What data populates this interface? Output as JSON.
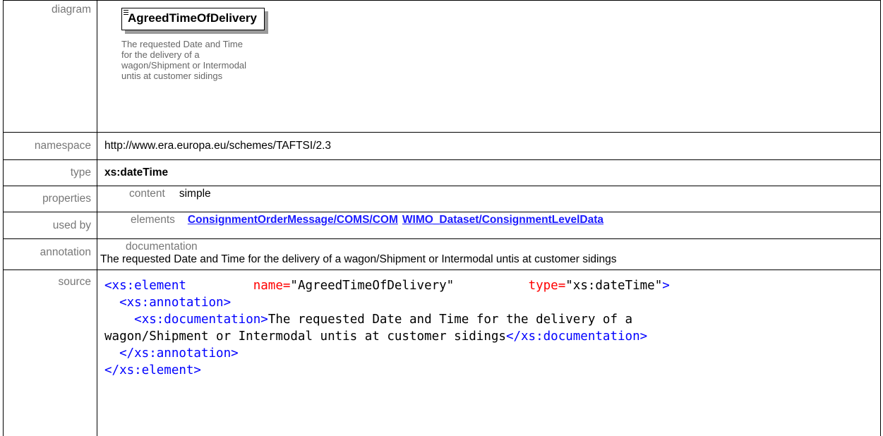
{
  "heading": "Agreed Time Of Delivery",
  "labels": {
    "diagram": "diagram",
    "namespace": "namespace",
    "type": "type",
    "properties": "properties",
    "used_by": "used by",
    "annotation": "annotation",
    "source": "source"
  },
  "diagram": {
    "element_name": "AgreedTimeOfDelivery",
    "doc_lines": [
      "The requested Date and Time",
      "for the delivery of a",
      "wagon/Shipment or Intermodal",
      "untis at customer sidings"
    ]
  },
  "namespace": "http://www.era.europa.eu/schemes/TAFTSI/2.3",
  "type": "xs:dateTime",
  "properties": {
    "key": "content",
    "value": "simple"
  },
  "used_by": {
    "key": "elements",
    "links": [
      "ConsignmentOrderMessage/COMS/COM",
      "WIMO_Dataset/ConsignmentLevelData"
    ]
  },
  "annotation": {
    "key": "documentation",
    "text": "The requested Date and Time for the delivery of a wagon/Shipment or Intermodal untis at customer sidings"
  },
  "source": {
    "l1_open": "<xs:element",
    "l1_attr1": "name=",
    "l1_val1": "\"AgreedTimeOfDelivery\"",
    "l1_attr2": "type=",
    "l1_val2": "\"xs:dateTime\"",
    "l1_close": ">",
    "l2": "<xs:annotation>",
    "l3_open": "<xs:documentation>",
    "l3_text": "The requested Date and Time for the delivery of a",
    "l4_text": "wagon/Shipment or Intermodal untis at customer sidings",
    "l4_close": "</xs:documentation>",
    "l5": "</xs:annotation>",
    "l6": "</xs:element>"
  },
  "colors": {
    "tag": "#a31515",
    "bracket": "#0000ff",
    "attr": "#ff0000",
    "value": "#0000ff",
    "link": "#1a1aff"
  }
}
